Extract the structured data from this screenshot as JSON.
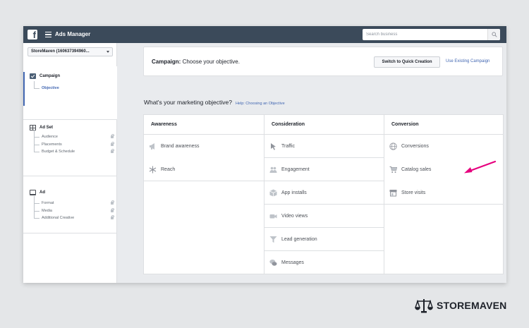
{
  "app": {
    "title": "Ads Manager",
    "search_placeholder": "Search business"
  },
  "sidebar": {
    "account": "StoreMaven (160637394960...",
    "sections": [
      {
        "title": "Campaign",
        "icon": "checkbox-icon",
        "items": [
          {
            "label": "Objective",
            "active": true,
            "locked": false
          }
        ]
      },
      {
        "title": "Ad Set",
        "icon": "adset-grid-icon",
        "items": [
          {
            "label": "Audience",
            "locked": true
          },
          {
            "label": "Placements",
            "locked": true
          },
          {
            "label": "Budget & Schedule",
            "locked": true
          }
        ]
      },
      {
        "title": "Ad",
        "icon": "ad-monitor-icon",
        "items": [
          {
            "label": "Format",
            "locked": true
          },
          {
            "label": "Media",
            "locked": true
          },
          {
            "label": "Additional Creative",
            "locked": true
          }
        ]
      }
    ]
  },
  "campaign_bar": {
    "label_bold": "Campaign:",
    "label_rest": " Choose your objective.",
    "quick_button": "Switch to Quick Creation",
    "existing_link": "Use Existing Campaign"
  },
  "objective": {
    "question": "What's your marketing objective?",
    "help": "Help: Choosing an Objective",
    "columns": [
      {
        "title": "Awareness",
        "options": [
          {
            "label": "Brand awareness",
            "icon": "megaphone-icon"
          },
          {
            "label": "Reach",
            "icon": "snowflake-icon"
          }
        ]
      },
      {
        "title": "Consideration",
        "options": [
          {
            "label": "Traffic",
            "icon": "cursor-icon"
          },
          {
            "label": "Engagement",
            "icon": "people-icon"
          },
          {
            "label": "App installs",
            "icon": "box-icon"
          },
          {
            "label": "Video views",
            "icon": "video-camera-icon"
          },
          {
            "label": "Lead generation",
            "icon": "funnel-icon"
          },
          {
            "label": "Messages",
            "icon": "chat-bubbles-icon"
          }
        ]
      },
      {
        "title": "Conversion",
        "options": [
          {
            "label": "Conversions",
            "icon": "globe-icon"
          },
          {
            "label": "Catalog sales",
            "icon": "cart-icon"
          },
          {
            "label": "Store visits",
            "icon": "store-icon"
          }
        ]
      }
    ]
  },
  "annotation": {
    "arrow_color": "#e6007e"
  },
  "brand": {
    "logo_text": "STOREMAVEN"
  },
  "colors": {
    "topbar": "#3b4a5a",
    "link": "#4267b2",
    "background": "#e4e6e8"
  }
}
